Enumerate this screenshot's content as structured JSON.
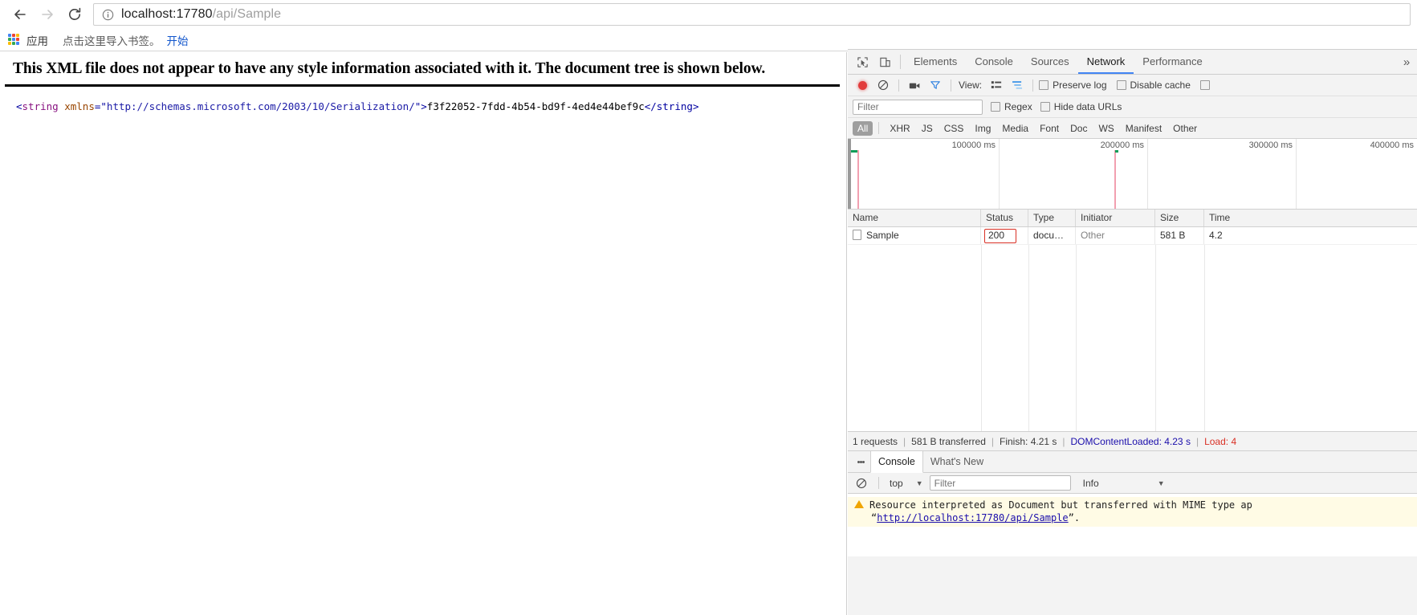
{
  "browser": {
    "nav": {
      "back_label": "Back",
      "forward_label": "Forward",
      "reload_label": "Reload"
    },
    "omnibox": {
      "info_icon": "info-circle-icon",
      "host": "localhost:17780",
      "path": "/api/Sample",
      "full_url": "localhost:17780/api/Sample"
    },
    "bookmarks": {
      "apps_label": "应用",
      "hint_text": "点击这里导入书签。",
      "start_link": "开始"
    }
  },
  "page": {
    "notice": "This XML file does not appear to have any style information associated with it. The document tree is shown below.",
    "xml": {
      "open_lt": "<",
      "tag_name": "string",
      "attr_name": "xmlns",
      "eq_quote": "=\"",
      "attr_value": "http://schemas.microsoft.com/2003/10/Serialization/",
      "quote_gt": "\">",
      "text_value": "f3f22052-7fdd-4b54-bd9f-4ed4e44bef9c",
      "close_tag": "</string>"
    }
  },
  "devtools": {
    "tabbar": {
      "inspect_icon": "inspect-element-icon",
      "device_icon": "device-toolbar-icon",
      "tabs": [
        {
          "label": "Elements",
          "active": false
        },
        {
          "label": "Console",
          "active": false
        },
        {
          "label": "Sources",
          "active": false
        },
        {
          "label": "Network",
          "active": true
        },
        {
          "label": "Performance",
          "active": false
        }
      ],
      "more_label": "»"
    },
    "toolbar": {
      "record_icon": "record-stop-icon",
      "clear_icon": "clear-icon",
      "capture_screenshots_icon": "camera-icon",
      "filter_icon": "funnel-icon",
      "view_label": "View:",
      "list_view_icon": "list-view-icon",
      "waterfall_view_icon": "waterfall-view-icon",
      "preserve_log_label": "Preserve log",
      "preserve_log_checked": false,
      "disable_cache_label": "Disable cache",
      "disable_cache_checked": false,
      "throttle_checked": false
    },
    "filterbar": {
      "filter_placeholder": "Filter",
      "filter_value": "",
      "regex_label": "Regex",
      "regex_checked": false,
      "hide_data_urls_label": "Hide data URLs",
      "hide_data_urls_checked": false
    },
    "types": [
      {
        "label": "All",
        "active": true
      },
      {
        "label": "XHR",
        "active": false
      },
      {
        "label": "JS",
        "active": false
      },
      {
        "label": "CSS",
        "active": false
      },
      {
        "label": "Img",
        "active": false
      },
      {
        "label": "Media",
        "active": false
      },
      {
        "label": "Font",
        "active": false
      },
      {
        "label": "Doc",
        "active": false
      },
      {
        "label": "WS",
        "active": false
      },
      {
        "label": "Manifest",
        "active": false
      },
      {
        "label": "Other",
        "active": false
      }
    ],
    "overview": {
      "ticks": [
        "100000 ms",
        "200000 ms",
        "300000 ms",
        "400000 ms"
      ]
    },
    "table": {
      "columns": [
        "Name",
        "Status",
        "Type",
        "Initiator",
        "Size",
        "Time"
      ],
      "rows": [
        {
          "name": "Sample",
          "status": "200",
          "type": "docu…",
          "initiator": "Other",
          "size": "581 B",
          "time": "4.2"
        }
      ]
    },
    "summary": {
      "requests": "1 requests",
      "transferred": "581 B transferred",
      "finish": "Finish: 4.21 s",
      "dom_content_loaded": "DOMContentLoaded: 4.23 s",
      "load": "Load: 4"
    },
    "drawer": {
      "tabs": [
        {
          "label": "Console",
          "active": true
        },
        {
          "label": "What's New",
          "active": false
        }
      ],
      "clear_icon": "clear-console-icon",
      "context": "top",
      "filter_placeholder": "Filter",
      "filter_value": "",
      "level": "Info",
      "messages": [
        {
          "icon": "warning-icon",
          "line1_pre": "Resource interpreted as Document but transferred with MIME type ap",
          "line2_quote_open": "“",
          "line2_link": "http://localhost:17780/api/Sample",
          "line2_quote_close": "”."
        }
      ]
    }
  },
  "colors": {
    "accent_blue": "#4285f4",
    "record_red": "#e23c3c",
    "status_border_red": "#d93025",
    "link_blue": "#1a0dab",
    "warning_yellow": "#f0a500",
    "timeline_green": "#0f9d58",
    "timeline_pink": "#f2a0b0"
  }
}
